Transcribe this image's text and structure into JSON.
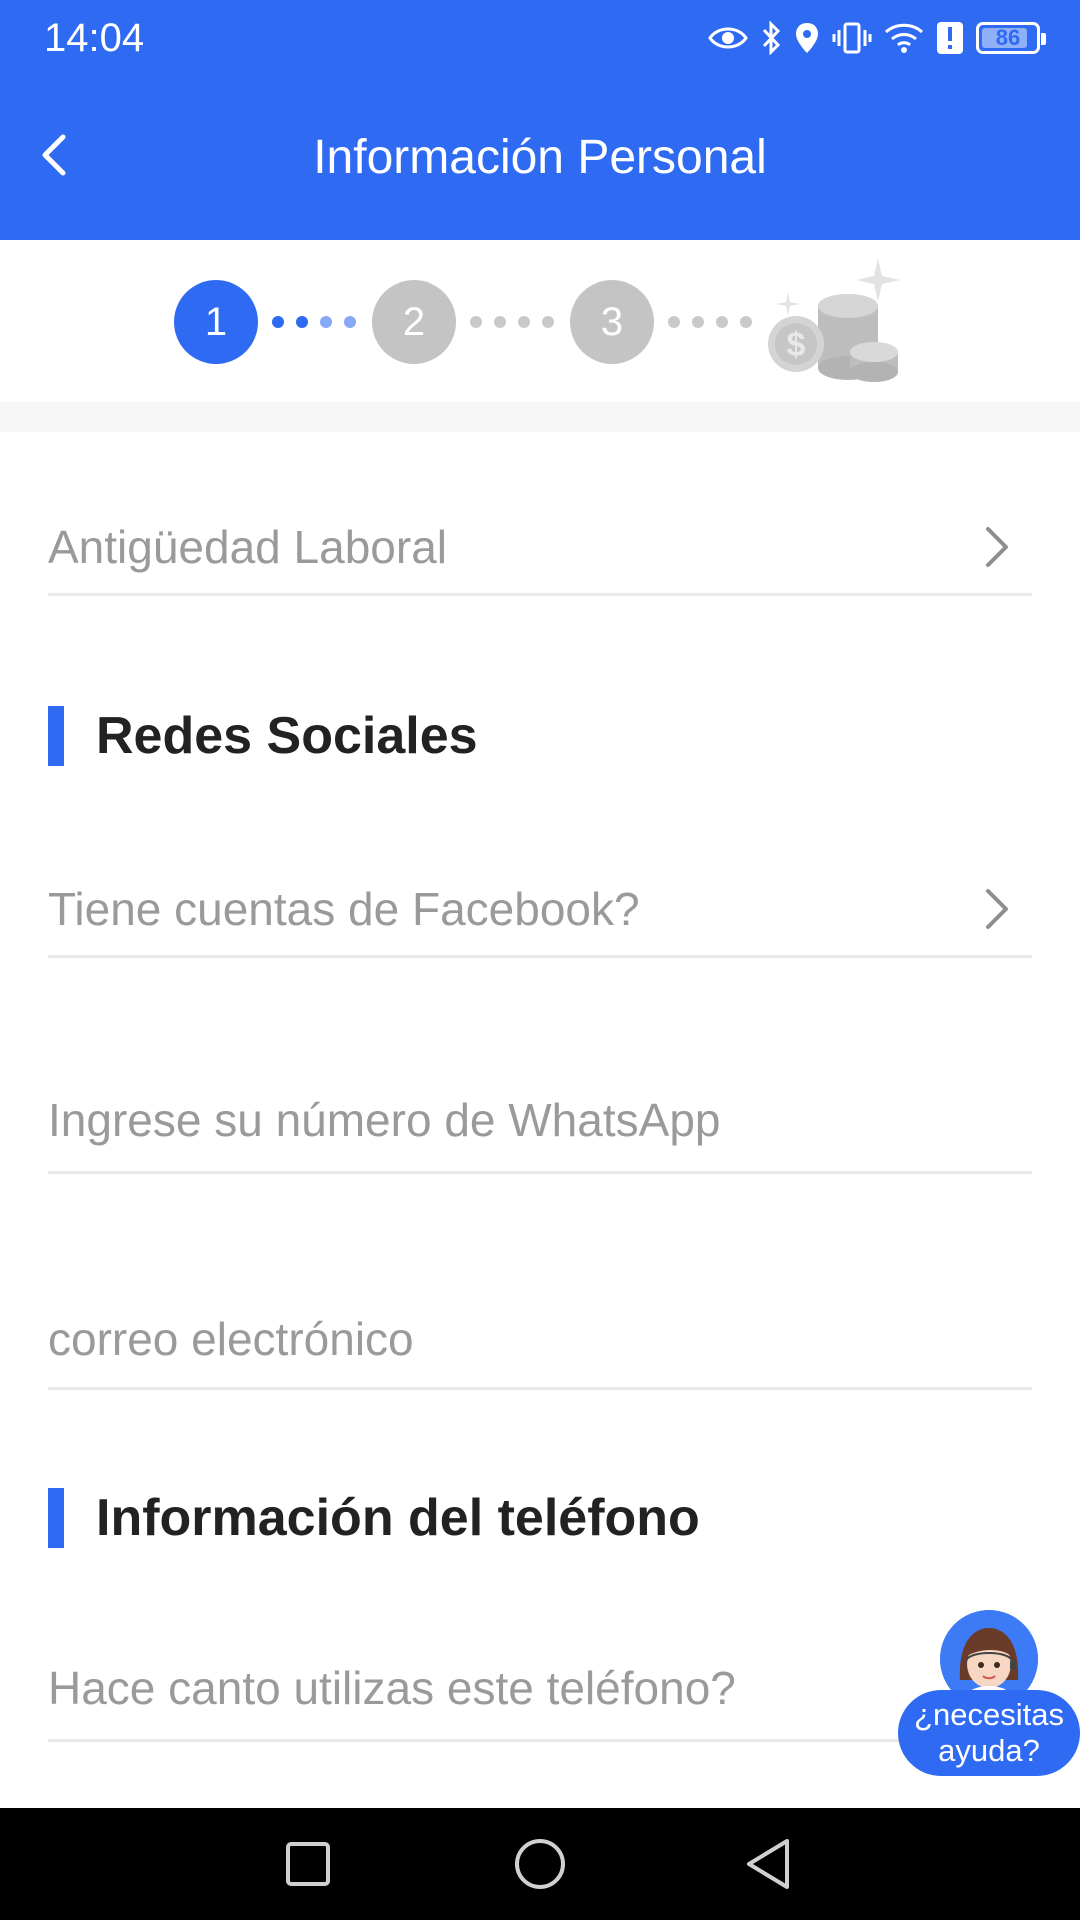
{
  "status_bar": {
    "time": "14:04",
    "battery": "86",
    "battery_level": 0.86,
    "icons": [
      "eye-icon",
      "bluetooth-icon",
      "location-icon",
      "vibrate-icon",
      "wifi-icon",
      "alert-icon",
      "battery-icon"
    ]
  },
  "header": {
    "title": "Información Personal",
    "back_icon": "chevron-left-icon"
  },
  "stepper": {
    "steps": [
      "1",
      "2",
      "3"
    ],
    "active_step": 1,
    "final_icon": "coins-icon"
  },
  "form": {
    "antiguedad_label": "Antigüedad Laboral",
    "redes_title": "Redes Sociales",
    "facebook_label": "Tiene cuentas de Facebook?",
    "whatsapp_placeholder": "Ingrese su número de WhatsApp",
    "correo_placeholder": "correo electrónico",
    "telefono_title": "Información del teléfono",
    "telefono_label": "Hace canto utilizas este teléfono?"
  },
  "help": {
    "line1": "¿necesitas",
    "line2": "ayuda?"
  },
  "nav": [
    "recents-icon",
    "home-icon",
    "back-icon"
  ],
  "colors": {
    "primary": "#2f6bf2",
    "inactive_step": "#c4c4c4",
    "placeholder_text": "#9a9a9a",
    "divider": "#e9e9e9"
  }
}
